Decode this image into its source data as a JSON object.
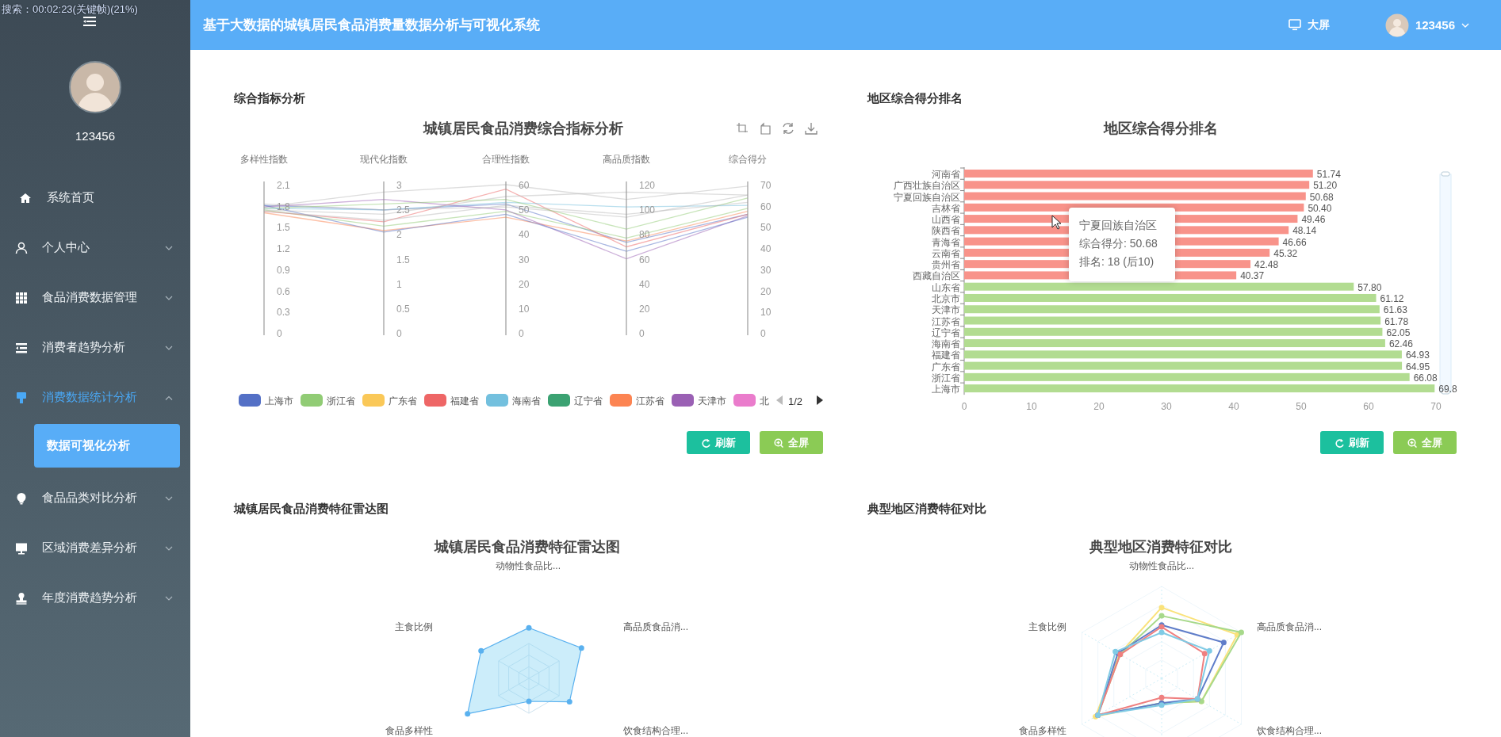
{
  "overlay": {
    "text": "搜索：00:02:23(关键帧)(21%)"
  },
  "header": {
    "title": "基于大数据的城镇居民食品消费量数据分析与可视化系统",
    "big_screen": "大屏",
    "user": "123456"
  },
  "sidebar": {
    "username": "123456",
    "items": [
      {
        "label": "系统首页",
        "selected": false
      },
      {
        "label": "个人中心",
        "selected": false,
        "expanded": false
      },
      {
        "label": "食品消费数据管理",
        "selected": false,
        "expanded": false
      },
      {
        "label": "消费者趋势分析",
        "selected": false,
        "expanded": false
      },
      {
        "label": "消费数据统计分析",
        "selected": false,
        "expanded": true,
        "children": [
          {
            "label": "数据可视化分析",
            "selected": true
          }
        ]
      },
      {
        "label": "食品品类对比分析",
        "selected": false,
        "expanded": false
      },
      {
        "label": "区域消费差异分析",
        "selected": false,
        "expanded": false
      },
      {
        "label": "年度消费趋势分析",
        "selected": false,
        "expanded": false
      }
    ]
  },
  "panels": [
    {
      "kind": "parallel",
      "heading": "综合指标分析",
      "chart_title": "城镇居民食品消费综合指标分析",
      "axes": [
        {
          "name": "多样性指数",
          "ticks": [
            "2.1",
            "1.8",
            "1.5",
            "1.2",
            "0.9",
            "0.6",
            "0.3",
            "0"
          ]
        },
        {
          "name": "现代化指数",
          "ticks": [
            "3",
            "2.5",
            "2",
            "1.5",
            "1",
            "0.5",
            "0"
          ]
        },
        {
          "name": "合理性指数",
          "ticks": [
            "60",
            "50",
            "40",
            "30",
            "20",
            "10",
            "0"
          ]
        },
        {
          "name": "高品质指数",
          "ticks": [
            "120",
            "100",
            "80",
            "60",
            "40",
            "20",
            "0"
          ]
        },
        {
          "name": "综合得分",
          "ticks": [
            "70",
            "60",
            "50",
            "40",
            "30",
            "20",
            "10",
            "0"
          ]
        }
      ],
      "legend": [
        {
          "name": "上海市",
          "color": "#5470c6"
        },
        {
          "name": "浙江省",
          "color": "#91cc75"
        },
        {
          "name": "广东省",
          "color": "#fac858"
        },
        {
          "name": "福建省",
          "color": "#ee6666"
        },
        {
          "name": "海南省",
          "color": "#73c0de"
        },
        {
          "name": "辽宁省",
          "color": "#3ba272"
        },
        {
          "name": "江苏省",
          "color": "#fc8452"
        },
        {
          "name": "天津市",
          "color": "#9a60b4"
        },
        {
          "name": "北",
          "color": "#ea7ccc"
        }
      ],
      "legend_pager": {
        "text": "1/2",
        "prev_disabled": true,
        "next_disabled": false
      },
      "buttons": [
        {
          "kind": "refresh",
          "label": "刷新"
        },
        {
          "kind": "fullscreen",
          "label": "全屏"
        }
      ]
    },
    {
      "kind": "bar",
      "heading": "地区综合得分排名",
      "chart_data": {
        "type": "bar",
        "title": "地区综合得分排名",
        "orientation": "horizontal",
        "categories": [
          "河南省",
          "广西壮族自治区",
          "宁夏回族自治区",
          "吉林省",
          "山西省",
          "陕西省",
          "青海省",
          "云南省",
          "贵州省",
          "西藏自治区",
          "山东省",
          "北京市",
          "天津市",
          "江苏省",
          "辽宁省",
          "海南省",
          "福建省",
          "广东省",
          "浙江省",
          "上海市"
        ],
        "series": [
          {
            "color": "#f8938a",
            "values": [
              51.74,
              51.2,
              50.68,
              50.4,
              49.46,
              48.14,
              46.66,
              45.32,
              42.48,
              40.37,
              null,
              null,
              null,
              null,
              null,
              null,
              null,
              null,
              null,
              null
            ]
          },
          {
            "color": "#b2dc91",
            "values": [
              null,
              null,
              null,
              null,
              null,
              null,
              null,
              null,
              null,
              null,
              57.8,
              61.12,
              61.63,
              61.78,
              62.05,
              62.46,
              64.93,
              64.95,
              66.08,
              69.8
            ]
          }
        ],
        "xlim": [
          0,
          70
        ],
        "xticks": [
          0,
          10,
          20,
          30,
          40,
          50,
          60,
          70
        ],
        "value_labels": [
          "51.74",
          "51.20",
          "50.68",
          "50.40",
          "49.46",
          "48.14",
          "46.66",
          "45.32",
          "42.48",
          "40.37",
          "57.80",
          "61.12",
          "61.63",
          "61.78",
          "62.05",
          "62.46",
          "64.93",
          "64.95",
          "66.08",
          "69.8"
        ]
      },
      "tooltip": {
        "title": "宁夏回族自治区",
        "lines": [
          "综合得分: 50.68",
          "排名: 18 (后10)"
        ]
      },
      "buttons": [
        {
          "kind": "refresh",
          "label": "刷新"
        },
        {
          "kind": "fullscreen",
          "label": "全屏"
        }
      ]
    },
    {
      "kind": "radar",
      "heading": "城镇居民食品消费特征雷达图",
      "chart_title": "城镇居民食品消费特征雷达图",
      "indicators": [
        "动物性食品比...",
        "主食比例",
        "高品质食品消...",
        "食品多样性",
        "饮食结构合理..."
      ]
    },
    {
      "kind": "radar_compare",
      "heading": "典型地区消费特征对比",
      "chart_title": "典型地区消费特征对比",
      "indicators": [
        "动物性食品比...",
        "主食比例",
        "高品质食品消...",
        "食品多样性",
        "饮食结构合理..."
      ]
    }
  ]
}
